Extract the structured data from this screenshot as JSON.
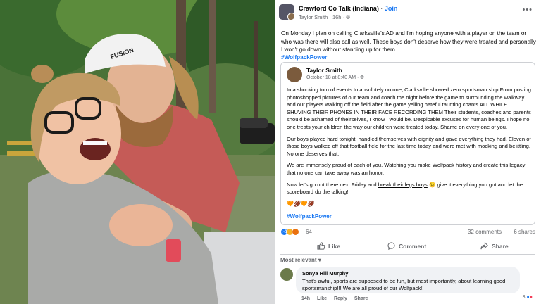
{
  "group": {
    "name": "Crawford Co Talk (Indiana)",
    "join_label": "Join",
    "author": "Taylor Smith",
    "time": "16h"
  },
  "post": {
    "text": "On Monday I plan on calling Clarksville's AD and I'm hoping anyone with a player on the team or who was there will also call as well. These boys don't deserve how they were treated and personally I won't go down without standing up for them.",
    "hashtag": "#WolfpackPower"
  },
  "shared": {
    "author": "Taylor Smith",
    "date": "October 18 at 8:40 AM",
    "p1": "In a shocking turn of events to absolutely no one, Clarksville showed zero sportsman ship  From posting photoshopped pictures of our team and coach the night before the game to surrounding the walkway and our players walking off the field after the game yelling hateful taunting chants ALL WHILE SHUVING THEIR PHONES IN THEIR FACE RECORDING THEM  Their students, coaches and parents should be ashamed of theirselves, I know I would be. Despicable excuses for human beings. I hope no one treats your children the way our children were treated today. Shame on every one of you.",
    "p2": "Our boys played hard tonight, handled themselves with dignity and gave everything they had. Eleven  of those boys walked off that football field for the last time today and were met with mocking and belittling. No one deserves that.",
    "p3": "We are immensely proud of each of you. Watching you make Wolfpack history and create this legacy that no one can take away was an honor.",
    "p4_start": "Now let's go out there next Friday and ",
    "p4_link": "break their legs boys",
    "p4_end": " 😉 give it everything you got and let the scoreboard do the talking!!",
    "emoji_row": "🧡🏈🧡🏈",
    "hashtag": "#WolfpackPower"
  },
  "reactions": {
    "count": "64",
    "comments": "32 comments",
    "shares": "6 shares"
  },
  "actions": {
    "like": "Like",
    "comment": "Comment",
    "share": "Share"
  },
  "most_relevant": "Most relevant",
  "comment": {
    "author": "Sonya Hill Murphy",
    "text": "That's awful, sports are supposed to be fun, but most importantly, about learning good sportsmanship!!! We are all proud of our Wolfpack!!",
    "time": "14h",
    "like": "Like",
    "reply": "Reply",
    "share": "Share",
    "react_count": "3"
  },
  "photo": {
    "hat_text": "FUSION"
  },
  "colors": {
    "link": "#1877f2",
    "meta": "#65676b",
    "text": "#050505"
  }
}
